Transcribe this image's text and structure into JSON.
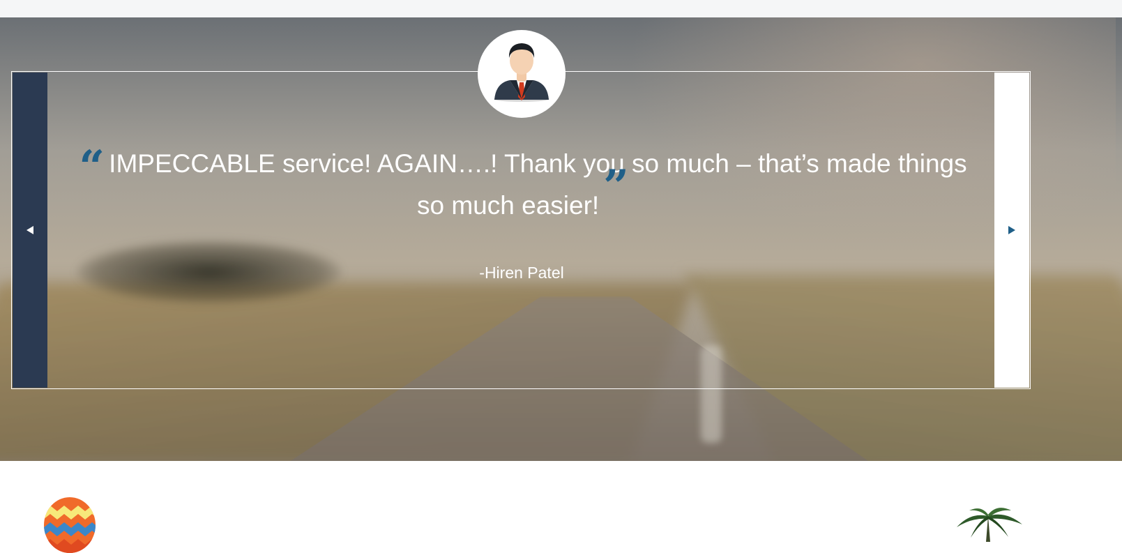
{
  "testimonial": {
    "quote": "IMPECCABLE service! AGAIN….! Thank you so much – that’s made things so much easier!",
    "open_quote_mark": "“",
    "close_quote_mark": "”",
    "author": "-Hiren Patel"
  },
  "carousel": {
    "prev_icon": "caret-left-icon",
    "next_icon": "caret-right-icon"
  },
  "colors": {
    "accent": "#1f5f88",
    "nav_dark": "#2b3a52",
    "text": "#ffffff"
  },
  "images": {
    "avatar": "businessman-avatar",
    "balloon": "hot-air-balloon",
    "palm": "palm-tree"
  }
}
